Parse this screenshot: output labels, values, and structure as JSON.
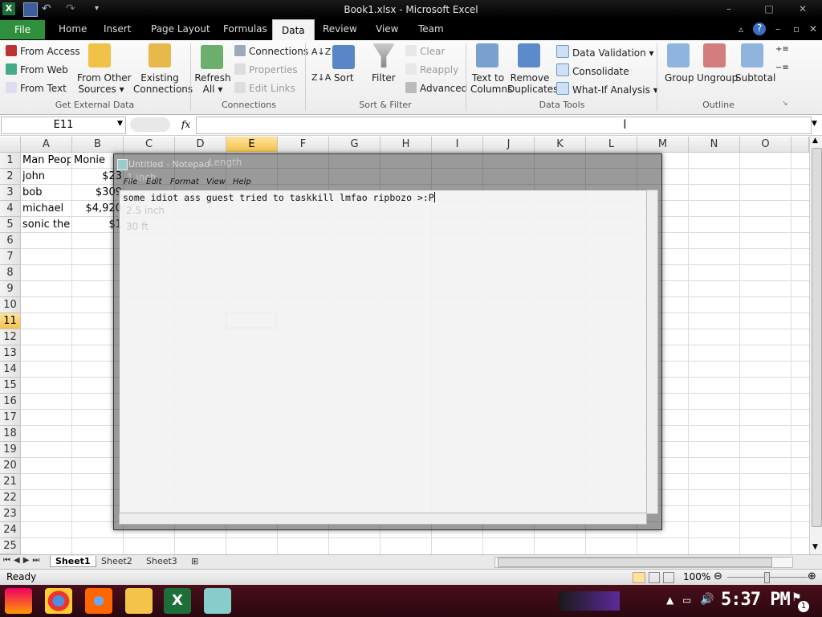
{
  "window": {
    "title": "Book1.xlsx  -  Microsoft Excel",
    "controls": [
      "–",
      "□",
      "✕"
    ]
  },
  "qat": {
    "app_icon": "X",
    "icons": [
      "save-icon",
      "undo-icon",
      "redo-icon",
      "customize-icon"
    ]
  },
  "tabs": {
    "file": "File",
    "items": [
      "Home",
      "Insert",
      "Page Layout",
      "Formulas",
      "Data",
      "Review",
      "View",
      "Team"
    ],
    "active": "Data"
  },
  "ribbon": {
    "get_external": {
      "from_access": "From Access",
      "from_web": "From Web",
      "from_text": "From Text",
      "from_other_1": "From Other",
      "from_other_2": "Sources ▾",
      "existing_1": "Existing",
      "existing_2": "Connections",
      "label": "Get External Data"
    },
    "connections": {
      "refresh_1": "Refresh",
      "refresh_2": "All ▾",
      "connections": "Connections",
      "properties": "Properties",
      "edit_links": "Edit Links",
      "label": "Connections"
    },
    "sort_filter": {
      "sort": "Sort",
      "filter": "Filter",
      "clear": "Clear",
      "reapply": "Reapply",
      "advanced": "Advanced",
      "label": "Sort & Filter"
    },
    "data_tools": {
      "text_cols_1": "Text to",
      "text_cols_2": "Columns",
      "remove_dup_1": "Remove",
      "remove_dup_2": "Duplicates",
      "validation": "Data Validation ▾",
      "consolidate": "Consolidate",
      "whatif": "What-If Analysis ▾",
      "label": "Data Tools"
    },
    "outline": {
      "group": "Group",
      "ungroup": "Ungroup",
      "subtotal": "Subtotal",
      "label": "Outline"
    }
  },
  "formula_bar": {
    "name_box": "E11",
    "fx": "fx",
    "value": ""
  },
  "columns": [
    "A",
    "B",
    "C",
    "D",
    "E",
    "F",
    "G",
    "H",
    "I",
    "J",
    "K",
    "L",
    "M",
    "N",
    "O"
  ],
  "selected_column": "E",
  "rows": [
    "1",
    "2",
    "3",
    "4",
    "5",
    "6",
    "7",
    "8",
    "9",
    "10",
    "11",
    "12",
    "13",
    "14",
    "15",
    "16",
    "17",
    "18",
    "19",
    "20",
    "21",
    "22",
    "23",
    "24",
    "25"
  ],
  "selected_row": "11",
  "cells": {
    "A1": "Man Peop",
    "B1": "Monie",
    "A2": "john",
    "B2": "$23",
    "A3": "bob",
    "B3": "$309",
    "A4": "michael",
    "B4": "$4,920",
    "A5": "sonic the h",
    "B5": "$1"
  },
  "ghost_text": {
    "d1": "Length",
    "c2": "1 inch",
    "c4": "2.5 inch",
    "c5": "30 ft"
  },
  "sheets": [
    "Sheet1",
    "Sheet2",
    "Sheet3"
  ],
  "active_sheet": "Sheet1",
  "status": {
    "ready": "Ready",
    "zoom": "100%"
  },
  "notepad": {
    "title": "Untitled - Notepad",
    "menu": [
      "File",
      "Edit",
      "Format",
      "View",
      "Help"
    ],
    "text": "some idiot ass guest tried to taskkill lmfao ripbozo >:P"
  },
  "taskbar": {
    "time": "5:37 PM",
    "notification_count": "1"
  },
  "colors": {
    "file_tab": "#2e8f3c",
    "taskbar": "#3a0c16",
    "selected_header": "#f5c24e"
  }
}
